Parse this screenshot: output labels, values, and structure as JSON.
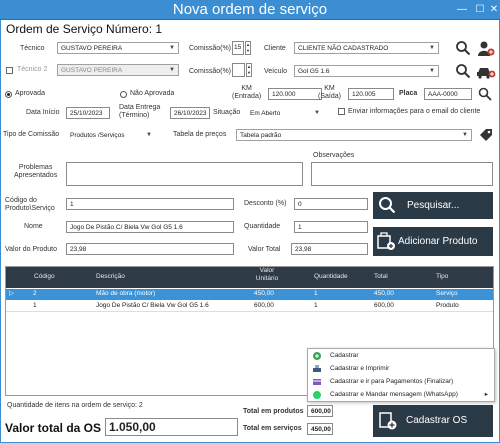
{
  "window": {
    "title": "Nova ordem de serviço"
  },
  "header": {
    "order_title": "Ordem de Serviço Número: 1"
  },
  "tecnico": {
    "label": "Técnico",
    "value": "GUSTAVO PEREIRA"
  },
  "tecnico2": {
    "label": "Técnico 2",
    "value": "GUSTAVO PEREIRA"
  },
  "comissao1": {
    "label": "Comissão(%)",
    "value": "15"
  },
  "comissao2": {
    "label": "Comissão(%)",
    "value": ""
  },
  "cliente": {
    "label": "Cliente",
    "value": "CLIENTE NÃO CADASTRADO"
  },
  "veiculo": {
    "label": "Veículo",
    "value": "Gol G5 1.6"
  },
  "status": {
    "aprovada": "Aprovada",
    "nao_aprovada": "Não Aprovada"
  },
  "km_entrada": {
    "label_line1": "KM",
    "label_line2": "(Entrada)",
    "value": "120.000"
  },
  "km_saida": {
    "label_line1": "KM",
    "label_line2": "(Saída)",
    "value": "120.005"
  },
  "placa": {
    "label": "Placa",
    "value": "AAA-0000"
  },
  "data_inicio": {
    "label": "Data Início",
    "value": "25/10/2023"
  },
  "data_entrega": {
    "label_line1": "Data Entrega",
    "label_line2": "(Término)",
    "value": "26/10/2023"
  },
  "situacao": {
    "label": "Situação",
    "value": "Em Aberto"
  },
  "enviar_email": {
    "label": "Enviar informações para o email do cliente"
  },
  "tipo_comissao": {
    "label": "Tipo de Comissão",
    "value": "Produtos /Serviços"
  },
  "tabela_precos": {
    "label": "Tabela de preços",
    "value": "Tabela padrão"
  },
  "observacoes": {
    "label": "Observações",
    "value": ""
  },
  "problemas": {
    "label_line1": "Problemas",
    "label_line2": "Apresentados",
    "value": ""
  },
  "codigo": {
    "label_line1": "Código do",
    "label_line2": "Produto\\Serviço",
    "value": "1"
  },
  "desconto": {
    "label": "Desconto (%)",
    "value": "0"
  },
  "nome": {
    "label": "Nome",
    "value": "Jogo De Pistão C/ Biela Vw Gol G5 1.6"
  },
  "quantidade": {
    "label": "Quantidade",
    "value": "1"
  },
  "valor_produto": {
    "label": "Valor do Produto",
    "value": "23,98"
  },
  "valor_total_item": {
    "label": "Valor Total",
    "value": "23,98"
  },
  "buttons": {
    "pesquisar": "Pesquisar...",
    "adicionar": "Adicionar Produto",
    "cadastrar_os": "Cadastrar OS"
  },
  "table": {
    "headers": [
      "Código",
      "Descrição",
      "Valor Unitário",
      "Quantidade",
      "Total",
      "Tipo"
    ],
    "rows": [
      {
        "codigo": "2",
        "descricao": "Mão de obra (motor)",
        "valor": "450,00",
        "quantidade": "1",
        "total": "450,00",
        "tipo": "Serviço",
        "selected": true
      },
      {
        "codigo": "1",
        "descricao": "Jogo De Pistão C/ Biela Vw Gol G5 1.6",
        "valor": "600,00",
        "quantidade": "1",
        "total": "600,00",
        "tipo": "Produto",
        "selected": false
      }
    ]
  },
  "menu": {
    "items": [
      "Cadastrar",
      "Cadastrar e Imprimir",
      "Cadastrar e ir para Pagamentos (Finalizar)",
      "Cadastrar e Mandar mensagem (WhatsApp)"
    ]
  },
  "footer": {
    "quantidade_itens": "Quantidade de itens na ordem de serviço: 2",
    "total_produtos_label": "Total em produtos",
    "total_produtos_value": "600,00",
    "total_servicos_label": "Total em serviços",
    "total_servicos_value": "450,00",
    "valor_total_label": "Valor total da OS",
    "valor_total_value": "1.050,00"
  },
  "colors": {
    "titlebar": "#3b8ed1",
    "dark_button": "#2b3a47",
    "grid_header": "#2e3b47",
    "selected_row": "#3c92d6"
  }
}
